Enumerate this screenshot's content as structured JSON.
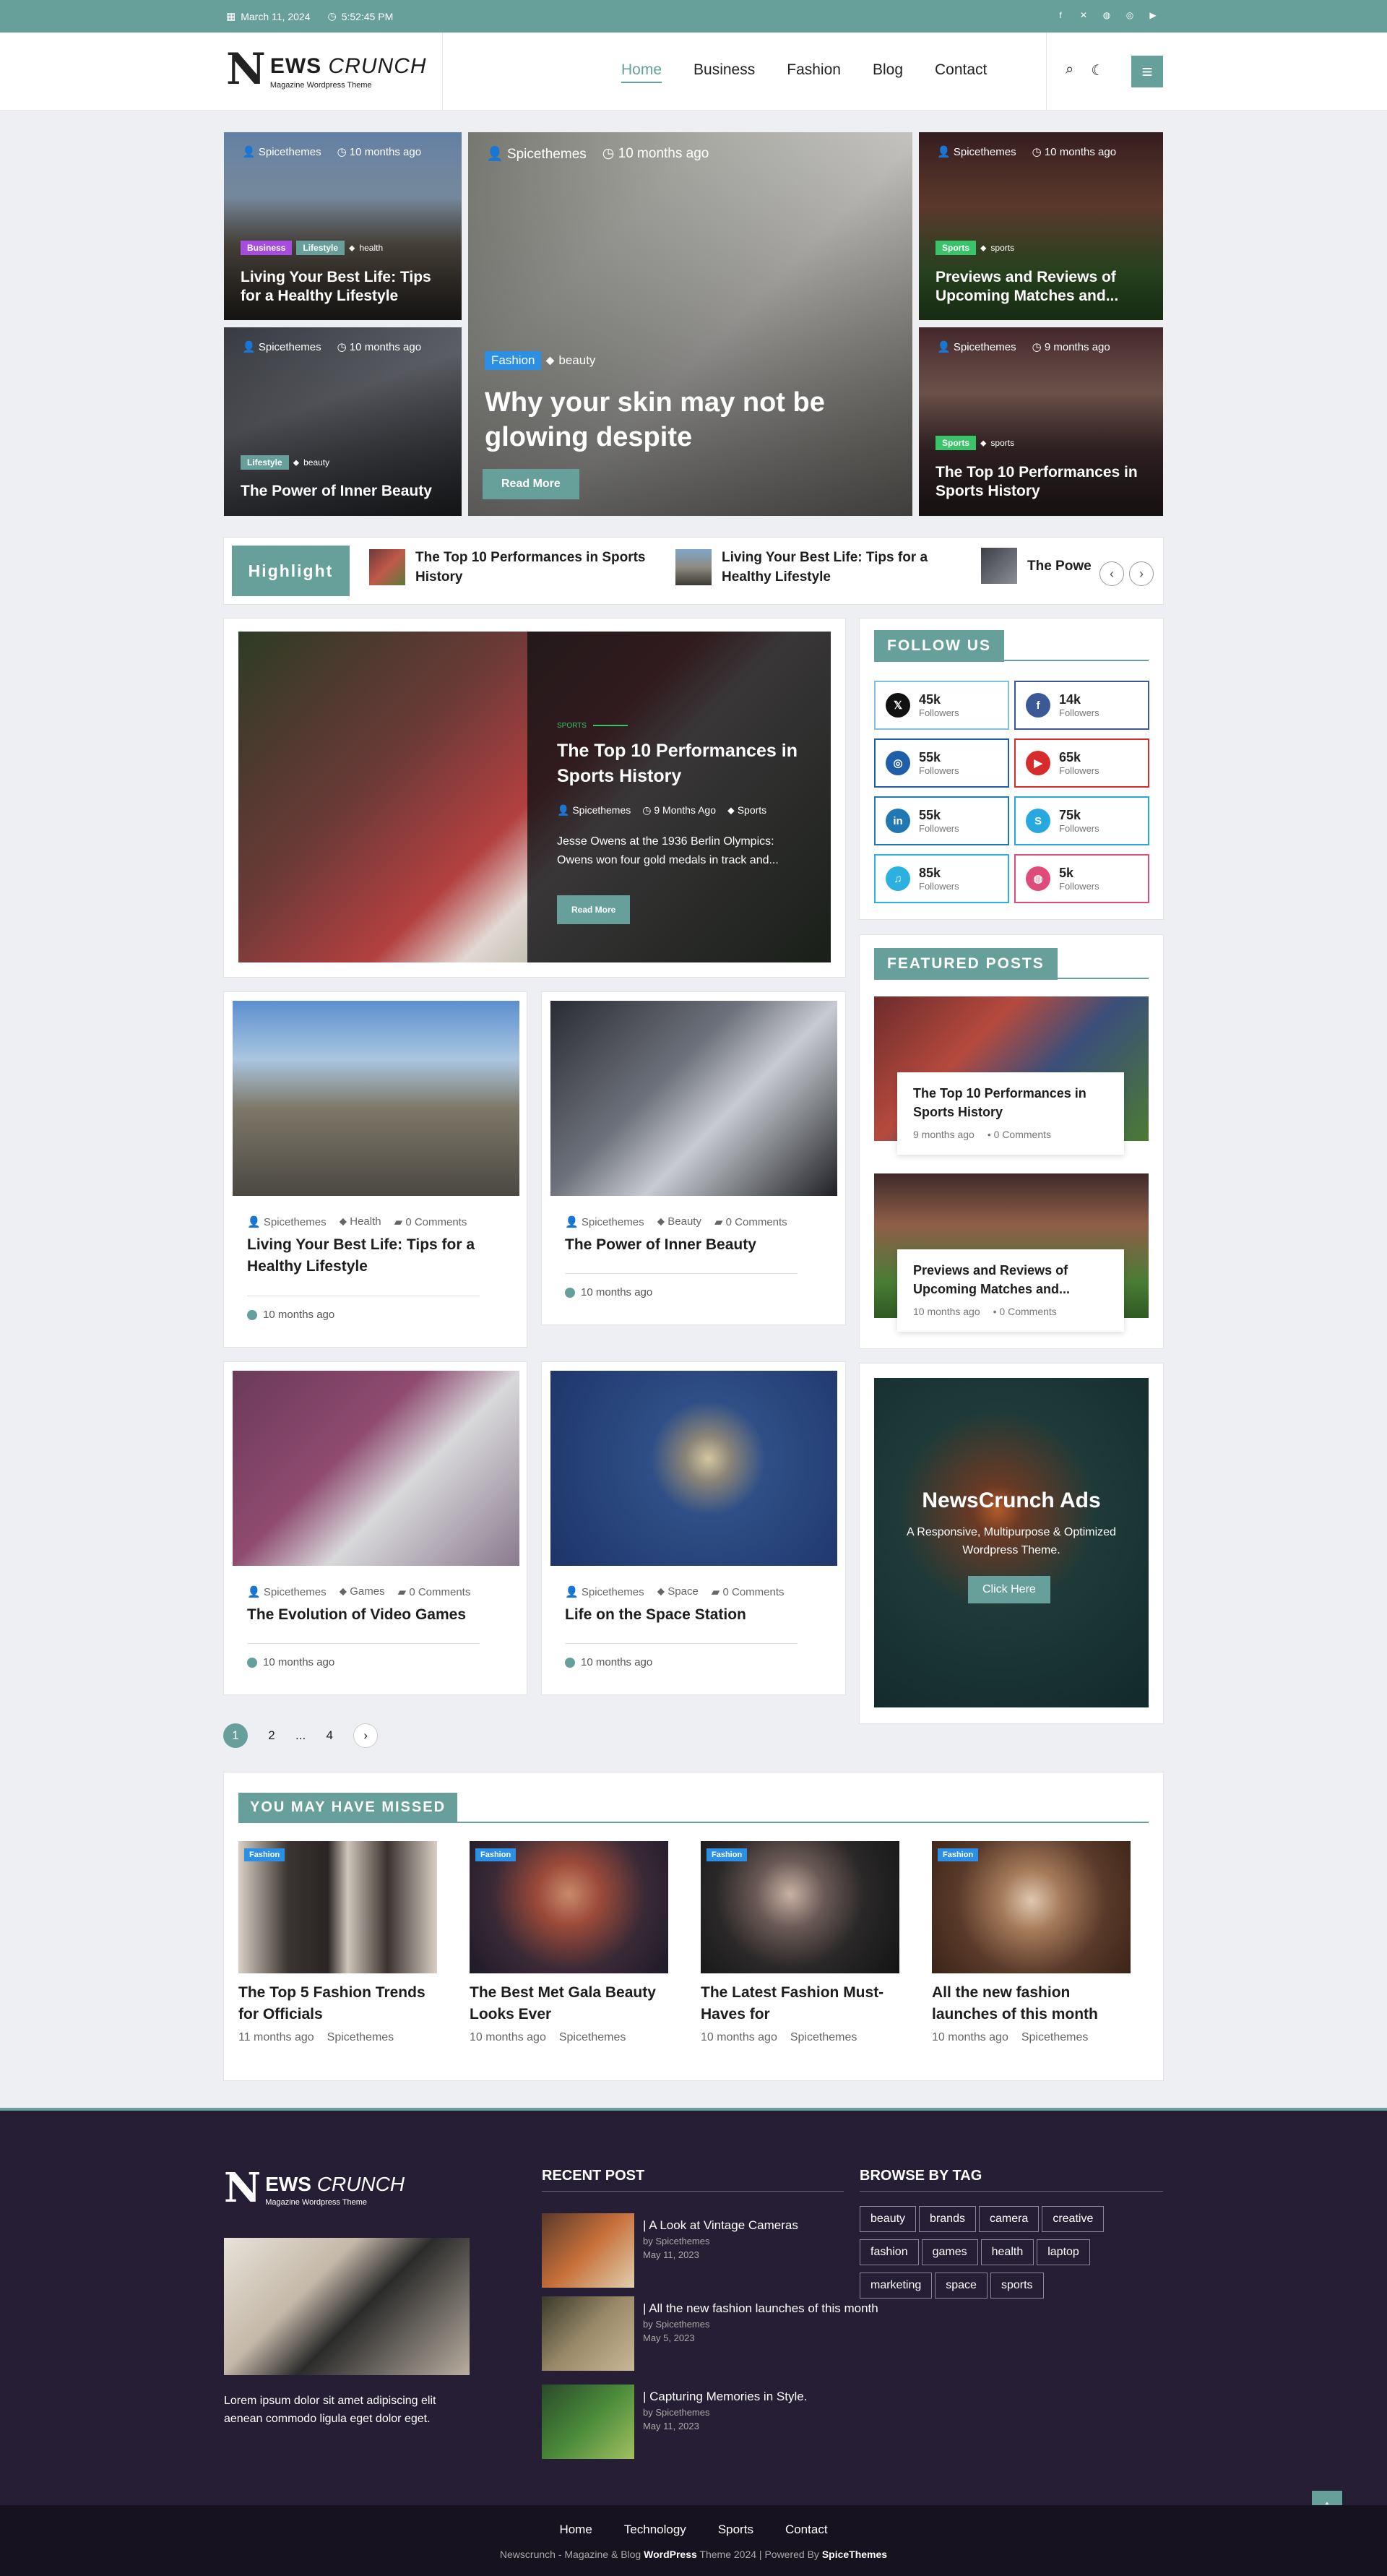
{
  "topbar": {
    "date": "March 11, 2024",
    "time": "5:52:45 PM"
  },
  "brand": {
    "n": "N",
    "name_bold": "EWS",
    "name_light": "CRUNCH",
    "tagline": "Magazine Wordpress Theme"
  },
  "nav": [
    "Home",
    "Business",
    "Fashion",
    "Blog",
    "Contact"
  ],
  "hero": [
    {
      "author": "Spicethemes",
      "ago": "10 months ago",
      "cats": [
        "Business",
        "Lifestyle"
      ],
      "tag": "health",
      "title": "Living Your Best Life: Tips for a Healthy Lifestyle"
    },
    {
      "author": "Spicethemes",
      "ago": "10 months ago",
      "cats": [
        "Lifestyle"
      ],
      "tag": "beauty",
      "title": "The Power of Inner Beauty"
    },
    {
      "author": "Spicethemes",
      "ago": "10 months ago",
      "cats": [
        "Fashion"
      ],
      "tag": "beauty",
      "title": "Why your skin may not be glowing despite",
      "button": "Read More"
    },
    {
      "author": "Spicethemes",
      "ago": "10 months ago",
      "cats": [
        "Sports"
      ],
      "tag": "sports",
      "title": "Previews and Reviews of Upcoming Matches and..."
    },
    {
      "author": "Spicethemes",
      "ago": "9 months ago",
      "cats": [
        "Sports"
      ],
      "tag": "sports",
      "title": "The Top 10 Performances in Sports History"
    }
  ],
  "colors": {
    "accent": "#67a09b",
    "business": "#a84ce0",
    "lifestyle": "#67a09b",
    "fashion": "#2b8fe6",
    "sports": "#39c46a"
  },
  "highlight": {
    "label": "Highlight",
    "items": [
      "The Top 10 Performances in Sports History",
      "Living Your Best Life: Tips for a Healthy Lifestyle",
      "The Powe"
    ]
  },
  "feature": {
    "cat": "SPORTS",
    "title": "The Top 10 Performances in Sports History",
    "author": "Spicethemes",
    "ago": "9 Months Ago",
    "tag": "Sports",
    "excerpt": "Jesse Owens at the 1936 Berlin Olympics: Owens won four gold medals in track and...",
    "button": "Read More"
  },
  "follow": {
    "title": "FOLLOW US",
    "label": "Followers",
    "items": [
      {
        "icon": "x-icon",
        "glyph": "𝕏",
        "count": "45k",
        "color": "#111111"
      },
      {
        "icon": "facebook-icon",
        "glyph": "f",
        "count": "14k",
        "color": "#3b5998"
      },
      {
        "icon": "instagram-icon",
        "glyph": "◎",
        "count": "55k",
        "color": "#1f5ea8"
      },
      {
        "icon": "youtube-icon",
        "glyph": "▶",
        "count": "65k",
        "color": "#d82b2b"
      },
      {
        "icon": "linkedin-icon",
        "glyph": "in",
        "count": "55k",
        "color": "#1f78b4"
      },
      {
        "icon": "skype-icon",
        "glyph": "S",
        "count": "75k",
        "color": "#28a8e0"
      },
      {
        "icon": "vk-icon",
        "glyph": "♫",
        "count": "85k",
        "color": "#2bb0e0"
      },
      {
        "icon": "dribbble-icon",
        "glyph": "◍",
        "count": "5k",
        "color": "#e04c7a"
      }
    ]
  },
  "featured": {
    "title": "FEATURED POSTS",
    "items": [
      {
        "title": "The Top 10 Performances in Sports History",
        "ago": "9 months ago",
        "comments": "0 Comments"
      },
      {
        "title": "Previews and Reviews of Upcoming Matches and...",
        "ago": "10 months ago",
        "comments": "0 Comments"
      }
    ]
  },
  "posts": [
    {
      "author": "Spicethemes",
      "cat": "Health",
      "comments": "0 Comments",
      "title": "Living Your Best Life: Tips for a Healthy Lifestyle",
      "ago": "10 months ago"
    },
    {
      "author": "Spicethemes",
      "cat": "Beauty",
      "comments": "0 Comments",
      "title": "The Power of Inner Beauty",
      "ago": "10 months ago"
    },
    {
      "author": "Spicethemes",
      "cat": "Games",
      "comments": "0 Comments",
      "title": "The Evolution of Video Games",
      "ago": "10 months ago"
    },
    {
      "author": "Spicethemes",
      "cat": "Space",
      "comments": "0 Comments",
      "title": "Life on the Space Station",
      "ago": "10 months ago"
    }
  ],
  "ads": {
    "title": "NewsCrunch Ads",
    "text": "A Responsive, Multipurpose & Optimized Wordpress Theme.",
    "button": "Click Here"
  },
  "pagination": [
    "1",
    "2",
    "...",
    "4"
  ],
  "missed": {
    "title": "YOU MAY HAVE MISSED",
    "items": [
      {
        "badge": "Fashion",
        "title": "The Top 5 Fashion Trends for Officials",
        "ago": "11 months ago",
        "author": "Spicethemes"
      },
      {
        "badge": "Fashion",
        "title": "The Best Met Gala Beauty Looks Ever",
        "ago": "10 months ago",
        "author": "Spicethemes"
      },
      {
        "badge": "Fashion",
        "title": "The Latest Fashion Must-Haves for",
        "ago": "10 months ago",
        "author": "Spicethemes"
      },
      {
        "badge": "Fashion",
        "title": "All the new fashion launches of this month",
        "ago": "10 months ago",
        "author": "Spicethemes"
      }
    ]
  },
  "footer": {
    "about": "Lorem ipsum dolor sit amet adipiscing elit aenean commodo ligula eget dolor eget.",
    "recent_title": "RECENT POST",
    "recent": [
      {
        "title": "A Look at Vintage Cameras",
        "by": "by Spicethemes",
        "date": "May 11, 2023"
      },
      {
        "title": "All the new fashion launches of this month",
        "by": "by Spicethemes",
        "date": "May 5, 2023"
      },
      {
        "title": "Capturing Memories in Style.",
        "by": "by Spicethemes",
        "date": "May 11, 2023"
      }
    ],
    "tags_title": "BROWSE BY TAG",
    "tags": [
      "beauty",
      "brands",
      "camera",
      "creative",
      "fashion",
      "games",
      "health",
      "laptop",
      "marketing",
      "space",
      "sports"
    ],
    "menu": [
      "Home",
      "Technology",
      "Sports",
      "Contact"
    ],
    "copy_a": "Newscrunch - Magazine & Blog ",
    "copy_b": "WordPress",
    "copy_c": " Theme 2024 | Powered By ",
    "copy_d": "SpiceThemes"
  }
}
